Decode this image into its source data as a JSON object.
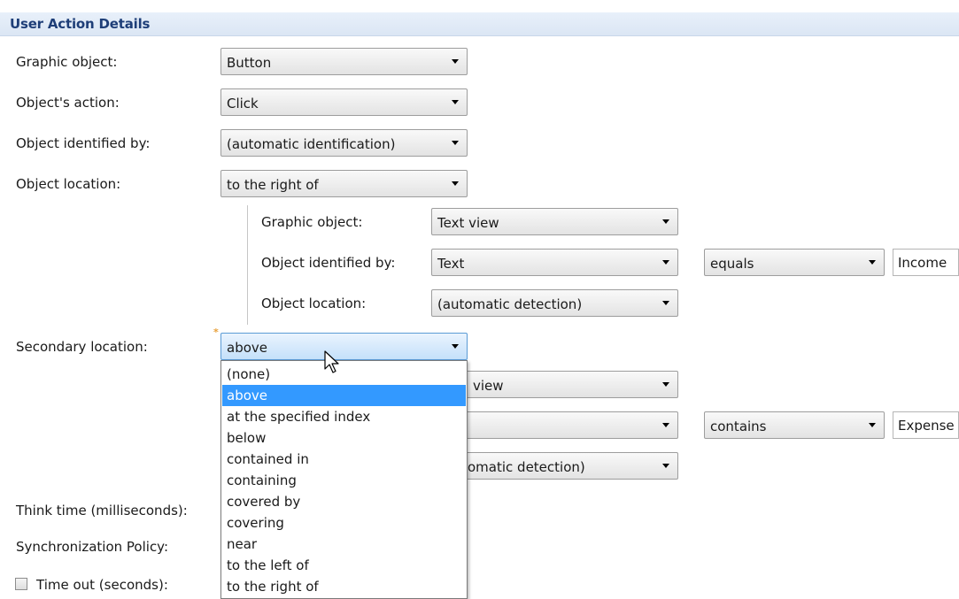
{
  "section_title": "User Action Details",
  "main": {
    "graphic_object": {
      "label": "Graphic object:",
      "value": "Button"
    },
    "objects_action": {
      "label": "Object's action:",
      "value": "Click"
    },
    "identified_by": {
      "label": "Object identified by:",
      "value": "(automatic identification)"
    },
    "object_location": {
      "label": "Object location:",
      "value": "to the right of"
    }
  },
  "nested1": {
    "graphic_object": {
      "label": "Graphic object:",
      "value": "Text view"
    },
    "identified_by": {
      "label": "Object identified by:",
      "value": "Text",
      "operator": "equals",
      "text": "Income"
    },
    "object_location": {
      "label": "Object location:",
      "value": "(automatic detection)"
    }
  },
  "secondary": {
    "label": "Secondary location:",
    "value": "above",
    "required_marker": "*"
  },
  "nested2": {
    "graphic_object_partial": "view",
    "operator": "contains",
    "text": "Expense",
    "object_location_partial": "omatic detection)"
  },
  "dropdown": {
    "options": [
      "(none)",
      "above",
      "at the specified index",
      "below",
      "contained in",
      "containing",
      "covered by",
      "covering",
      "near",
      "to the left of",
      "to the right of"
    ],
    "selected": "above"
  },
  "footer": {
    "think_time_label": "Think time (milliseconds):",
    "sync_policy_label": "Synchronization Policy:",
    "timeout_label": "Time out (seconds):"
  },
  "icons": {
    "dropdown_arrow": "chevron-down-icon",
    "pointer": "mouse-pointer-icon",
    "checkbox": "checkbox-icon"
  },
  "colors": {
    "header_text": "#1e3e78",
    "header_bg": "#dbe6f4",
    "selection": "#3399ff",
    "required_marker": "#e8a03a"
  }
}
